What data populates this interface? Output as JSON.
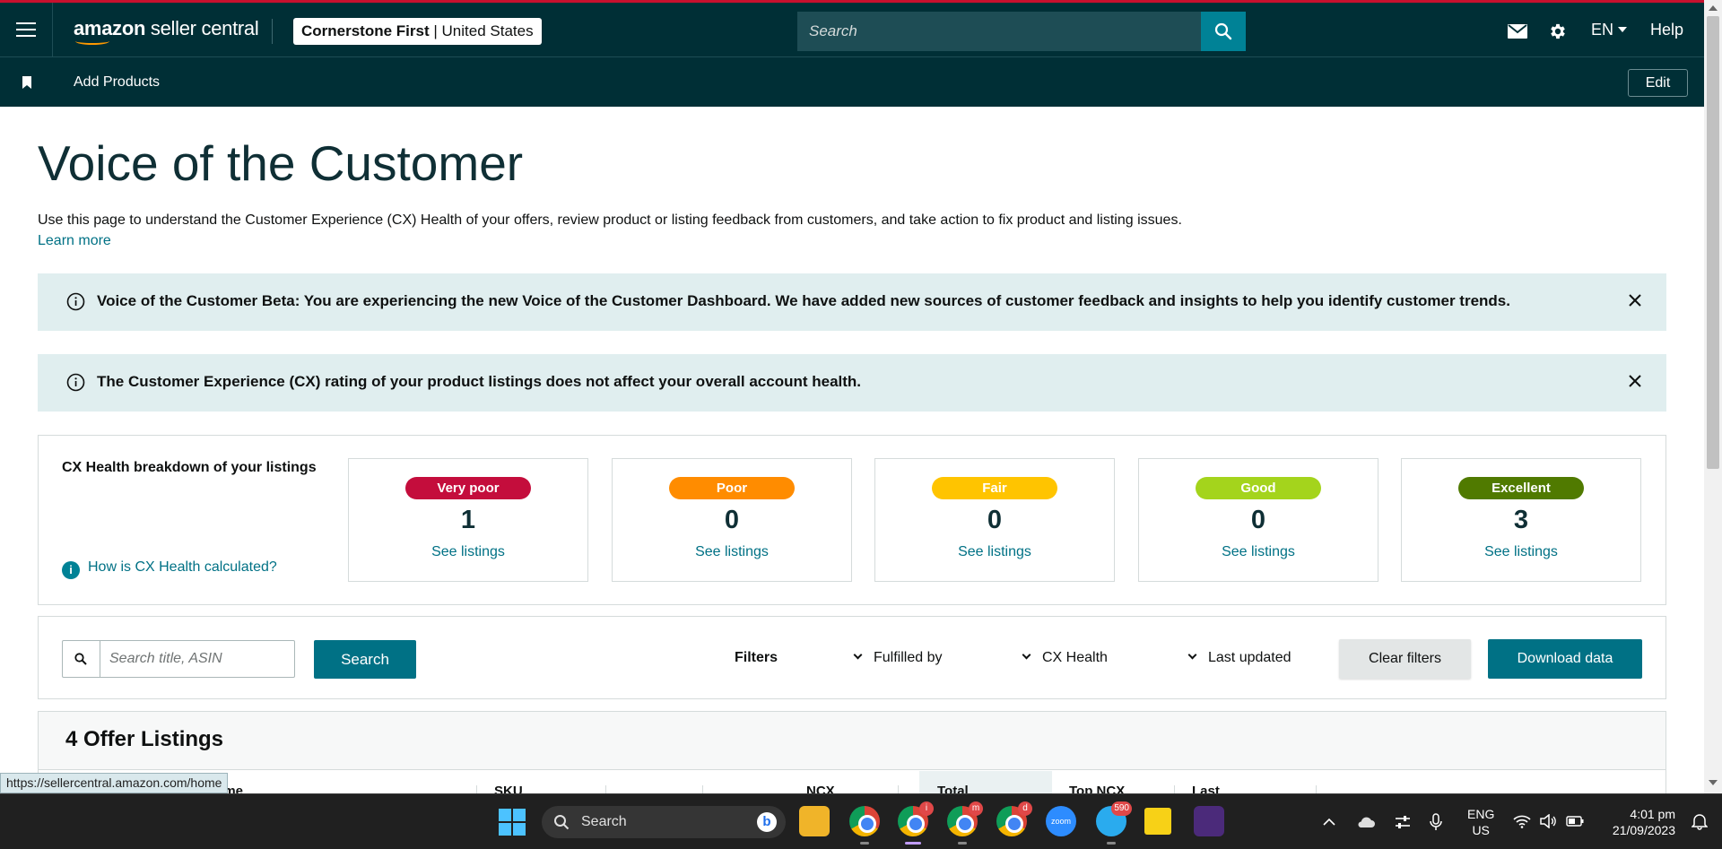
{
  "header": {
    "logo_bold": "amazon",
    "logo_rest": " seller central",
    "account_name": "Cornerstone First",
    "account_sep": " | ",
    "account_region": "United States",
    "search_placeholder": "Search",
    "language": "EN",
    "help": "Help"
  },
  "subbar": {
    "add_products": "Add Products",
    "edit": "Edit"
  },
  "page": {
    "title": "Voice of the Customer",
    "intro": "Use this page to understand the Customer Experience (CX) Health of your offers, review product or listing feedback from customers, and take action to fix product and listing issues.",
    "learn_more": "Learn more"
  },
  "banners": [
    {
      "message": "Voice of the Customer Beta: You are experiencing the new Voice of the Customer Dashboard. We have added new sources of customer feedback and insights to help you identify customer trends."
    },
    {
      "message": "The Customer Experience (CX) rating of your product listings does not affect your overall account health."
    }
  ],
  "cx_health": {
    "title": "CX Health breakdown of your listings",
    "how_link": "How is CX Health calculated?",
    "info_glyph": "i",
    "tiles": [
      {
        "label": "Very poor",
        "count": "1",
        "link": "See listings",
        "color": "#c40d3c"
      },
      {
        "label": "Poor",
        "count": "0",
        "link": "See listings",
        "color": "#ff8c00"
      },
      {
        "label": "Fair",
        "count": "0",
        "link": "See listings",
        "color": "#ffc400"
      },
      {
        "label": "Good",
        "count": "0",
        "link": "See listings",
        "color": "#a4d41c"
      },
      {
        "label": "Excellent",
        "count": "3",
        "link": "See listings",
        "color": "#507a00"
      }
    ]
  },
  "filters": {
    "search_placeholder": "Search title, ASIN",
    "search_button": "Search",
    "label": "Filters",
    "dropdowns": [
      "Fulfilled by",
      "CX Health",
      "Last updated"
    ],
    "clear": "Clear filters",
    "download": "Download data"
  },
  "offers": {
    "title": "4 Offer Listings",
    "columns": [
      "Product name",
      "SKU",
      "NCX",
      "Total",
      "Top NCX",
      "Last"
    ]
  },
  "status_url": "https://sellercentral.amazon.com/home",
  "taskbar": {
    "search_label": "Search",
    "bing_glyph": "b",
    "zoom_label": "zoom",
    "chrome_badges": [
      "i",
      "m",
      "d"
    ],
    "telegram_badge": "590",
    "lang_top": "ENG",
    "lang_bottom": "US",
    "time": "4:01 pm",
    "date": "21/09/2023"
  },
  "colors": {
    "nav_bg": "#002f36",
    "accent": "#007185",
    "banner_bg": "#e0eeef"
  }
}
